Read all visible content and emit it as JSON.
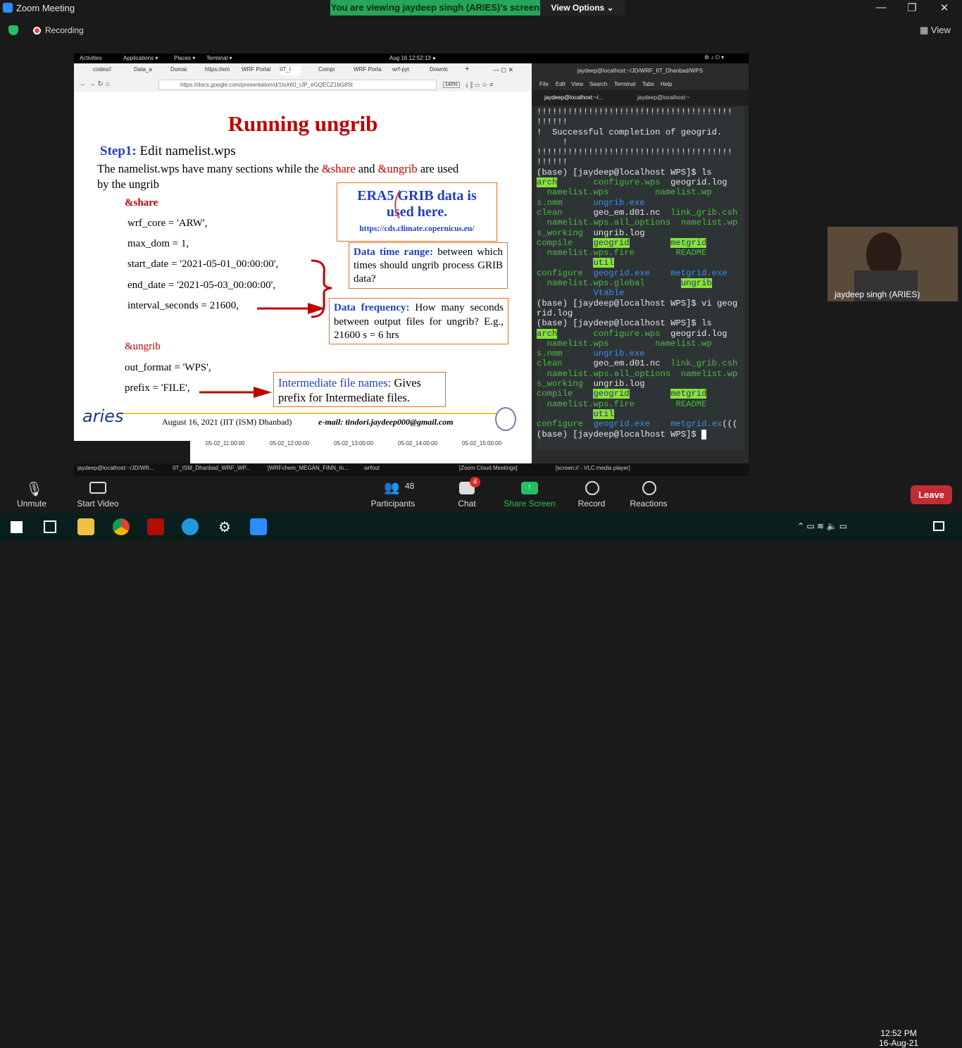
{
  "zoom": {
    "title": "Zoom Meeting",
    "banner": "You are viewing jaydeep singh (ARIES)'s screen",
    "view_options": "View Options ⌄",
    "recording": "Recording",
    "view": "View",
    "win_btns": [
      "—",
      "❐",
      "✕"
    ]
  },
  "gnome": {
    "activities": "Activities",
    "applications": "Applications ▾",
    "places": "Places ▾",
    "terminal": "Terminal ▾",
    "datetime": "Aug 16  12:52:13 ●"
  },
  "firefox": {
    "tabs": [
      "codes//",
      "Data_a",
      "Domai",
      "https://em",
      "WRF Portal",
      "IIT_I",
      "Compi",
      "WRF Porta",
      "wrf-pyt",
      "Downlc"
    ],
    "url": "https://docs.google.com/presentation/d/1tsX60_tJP_eGQECZ1bG8St",
    "zoom": "140%"
  },
  "slide": {
    "title": "Running ungrib",
    "step_label": "Step1:",
    "step_text": " Edit namelist.wps",
    "intro_1": "The namelist.wps have many sections while the ",
    "intro_share": "&share",
    "intro_and": " and ",
    "intro_ungrib": "&ungrib",
    "intro_2": " are used",
    "intro_3": "by the ungrib",
    "share_hdr": "&share",
    "l1": "wrf_core = 'ARW',",
    "l2": "max_dom = 1,",
    "l3": "start_date = '2021-05-01_00:00:00',",
    "l4": "end_date   = '2021-05-03_00:00:00',",
    "l5": "interval_seconds = 21600,",
    "ungrib_hdr": "&ungrib",
    "l6": "out_format = 'WPS',",
    "l7": "prefix = 'FILE',",
    "era_1": "ERA5 GRIB data is",
    "era_2": "used here.",
    "era_url": "https://cds.climate.copernicus.eu/",
    "dtr_label": "Data time range:",
    "dtr_text": " between which times should ungrib process GRIB data?",
    "df_label": "Data frequency:",
    "df_text": " How many seconds between output files for ungrib? E.g., 21600 s = 6 hrs",
    "ifn_label": "Intermediate file names:",
    "ifn_text": " Gives prefix for Intermediate files.",
    "footer": "August 16, 2021 (IIT (ISM) Dhanbad)",
    "email": "e-mail: tindori.jaydeep000@gmail.com",
    "logo": "aries",
    "below_ticks": [
      "05-02_11:00:00",
      "05-02_12:00:00",
      "05-02_13:00:00",
      "05-02_14:00:00",
      "05-02_15:00:00"
    ]
  },
  "terminal": {
    "title": "jaydeep@localhost:~/JD/WRF_IIT_Dhanbad/WPS",
    "menu": [
      "File",
      "Edit",
      "View",
      "Search",
      "Terminal",
      "Tabs",
      "Help"
    ],
    "tab1": "jaydeep@localhost:~/...",
    "tab2": "jaydeep@localhost:~"
  },
  "inner_taskbar": [
    "jaydeep@localhost:~/JD/WR...",
    "IIT_ISM_Dhanbad_WRF_WP...",
    "[WRFchem_MEGAN_FINN_In...",
    "wrfout",
    "[Zoom Cloud Meetings]",
    "[screen:// - VLC media player]"
  ],
  "video": {
    "name": "jaydeep singh (ARIES)"
  },
  "toolbar": {
    "unmute": "Unmute",
    "start_video": "Start Video",
    "participants": "Participants",
    "participants_count": "48",
    "chat": "Chat",
    "chat_badge": "4",
    "share": "Share Screen",
    "record": "Record",
    "reactions": "Reactions",
    "leave": "Leave"
  },
  "clock": {
    "time": "12:52 PM",
    "date": "16-Aug-21"
  }
}
